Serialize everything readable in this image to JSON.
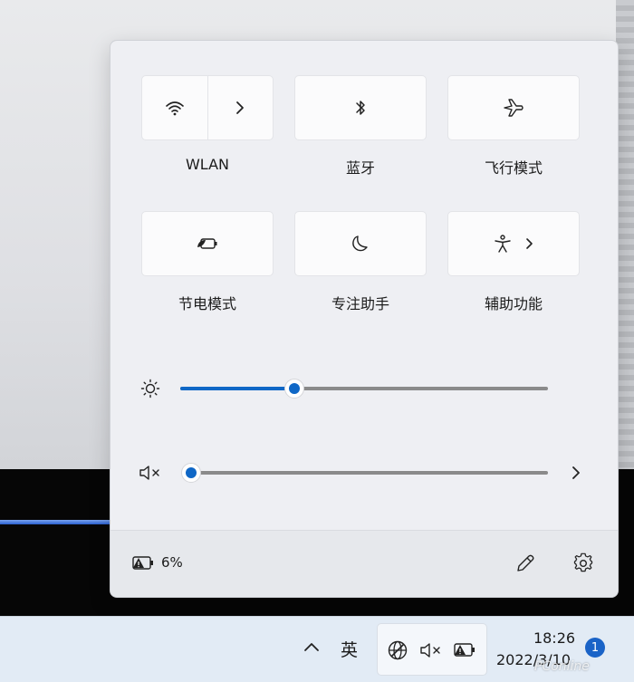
{
  "quick_settings": {
    "tiles": [
      {
        "id": "wlan",
        "label": "WLAN",
        "icon": "wifi-icon",
        "has_chevron": true
      },
      {
        "id": "bluetooth",
        "label": "蓝牙",
        "icon": "bluetooth-icon"
      },
      {
        "id": "airplane",
        "label": "飞行模式",
        "icon": "airplane-icon"
      },
      {
        "id": "battery-saver",
        "label": "节电模式",
        "icon": "battery-saver-icon"
      },
      {
        "id": "focus-assist",
        "label": "专注助手",
        "icon": "moon-icon"
      },
      {
        "id": "accessibility",
        "label": "辅助功能",
        "icon": "accessibility-icon",
        "has_chevron": true
      }
    ],
    "brightness": {
      "icon": "brightness-icon",
      "level_percent": 31
    },
    "volume": {
      "icon": "volume-muted-icon",
      "level_percent": 0
    },
    "footer": {
      "battery_percent_text": "6%",
      "battery_icon": "battery-warning-icon",
      "edit_icon": "pencil-icon",
      "settings_icon": "gear-icon"
    }
  },
  "taskbar": {
    "ime_label": "英",
    "clock_time": "18:26",
    "clock_date": "2022/3/10",
    "notification_count": "1"
  },
  "watermark": "PConline",
  "colors": {
    "accent": "#0f67c6",
    "panel_bg": "#eeeff3",
    "taskbar_bg": "#e2ebf5"
  }
}
